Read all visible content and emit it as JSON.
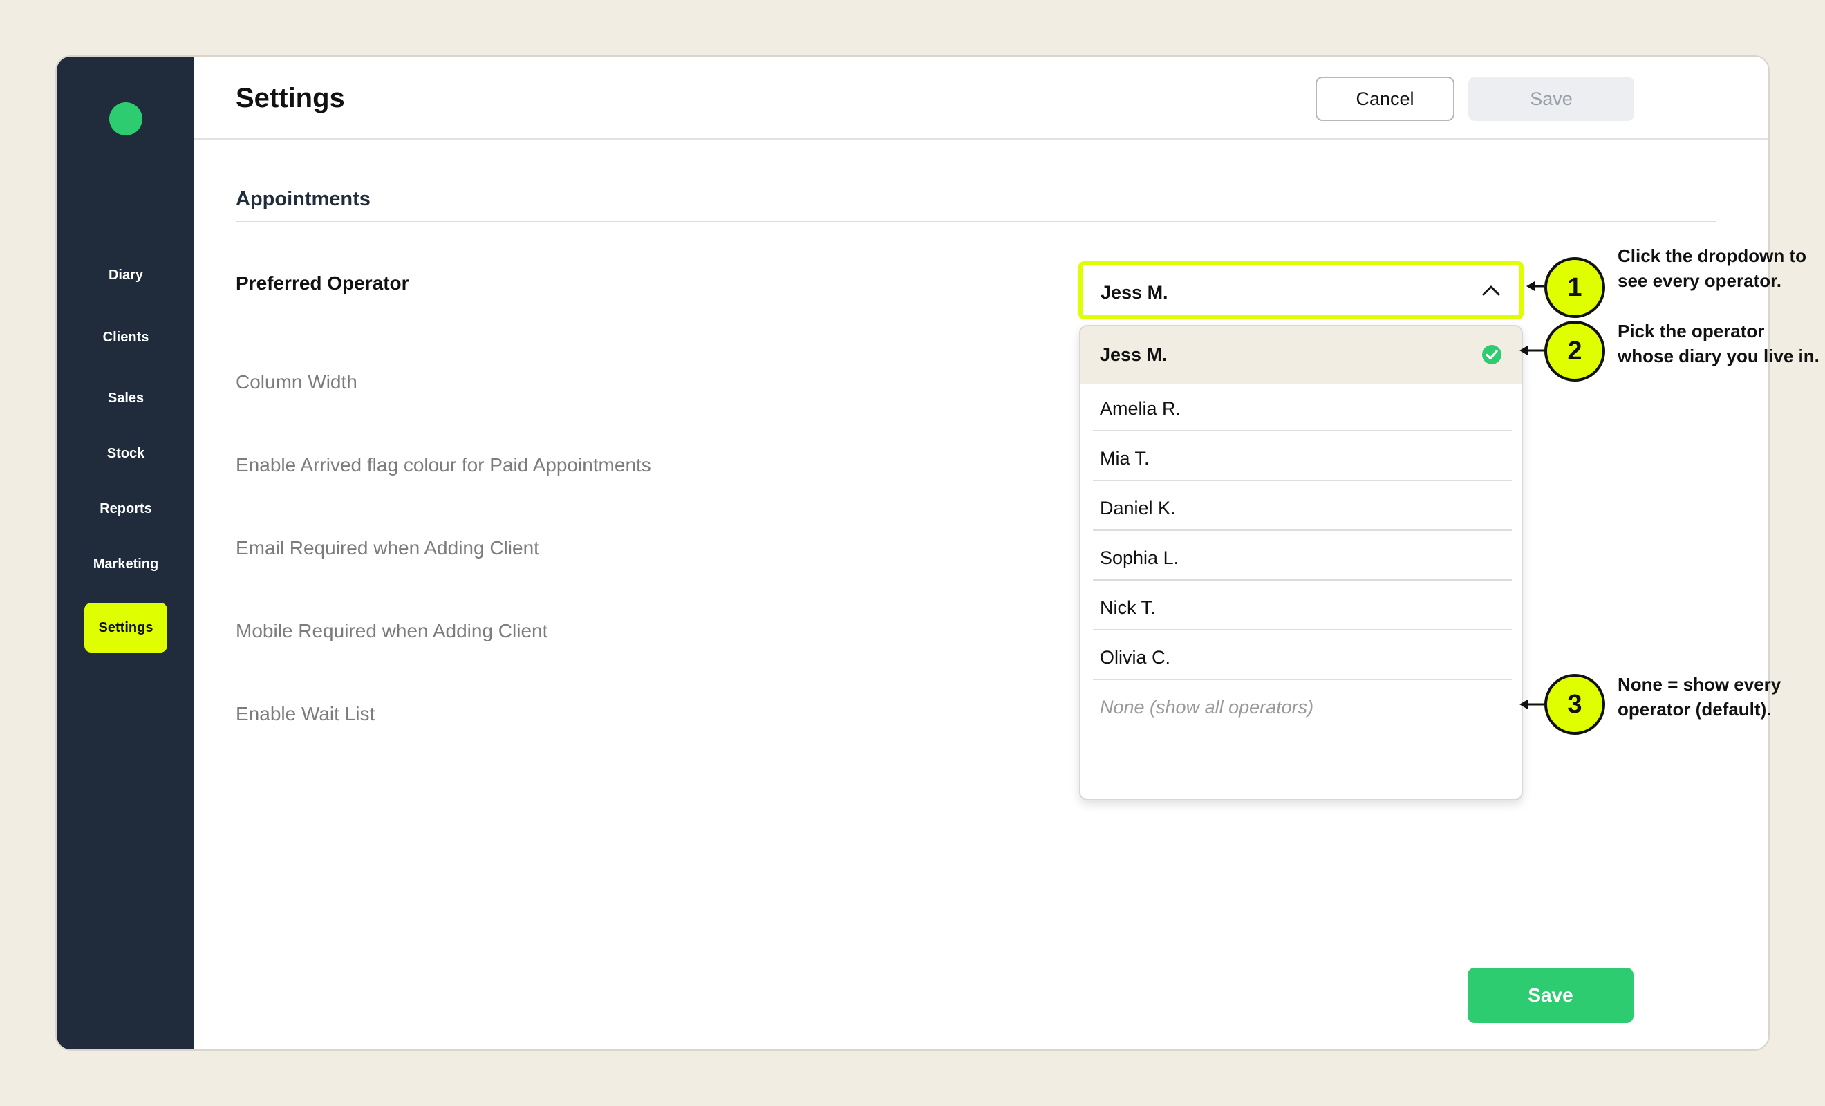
{
  "sidebar": {
    "items": [
      {
        "label": "Diary"
      },
      {
        "label": "Clients"
      },
      {
        "label": "Sales"
      },
      {
        "label": "Stock"
      },
      {
        "label": "Reports"
      },
      {
        "label": "Marketing"
      },
      {
        "label": "Settings",
        "active": true
      }
    ]
  },
  "header": {
    "title": "Settings",
    "cancel_label": "Cancel",
    "save_label": "Save"
  },
  "section": {
    "title": "Appointments",
    "rows": [
      {
        "label": "Preferred Operator"
      },
      {
        "label": "Column Width"
      },
      {
        "label": "Enable Arrived flag colour for Paid Appointments"
      },
      {
        "label": "Email Required when Adding Client"
      },
      {
        "label": "Mobile Required when Adding Client"
      },
      {
        "label": "Enable Wait List"
      }
    ]
  },
  "operator_select": {
    "value": "Jess M.",
    "options": [
      {
        "label": "Jess M.",
        "selected": true
      },
      {
        "label": "Amelia R."
      },
      {
        "label": "Mia T."
      },
      {
        "label": "Daniel K."
      },
      {
        "label": "Sophia L."
      },
      {
        "label": "Nick T."
      },
      {
        "label": "Olivia C."
      },
      {
        "label": "None (show all operators)"
      }
    ]
  },
  "callouts": [
    {
      "number": "1",
      "line1": "Click the dropdown to",
      "line2": "see every operator."
    },
    {
      "number": "2",
      "line1": "Pick the operator",
      "line2": "whose diary you live in."
    },
    {
      "number": "3",
      "line1": "None = show every",
      "line2": "operator (default)."
    }
  ],
  "footer": {
    "save_label": "Save"
  },
  "colors": {
    "sidebar_bg": "#202c3b",
    "accent": "#dfff00",
    "primary_green": "#2ecc71",
    "page_bg": "#f1ede3"
  }
}
